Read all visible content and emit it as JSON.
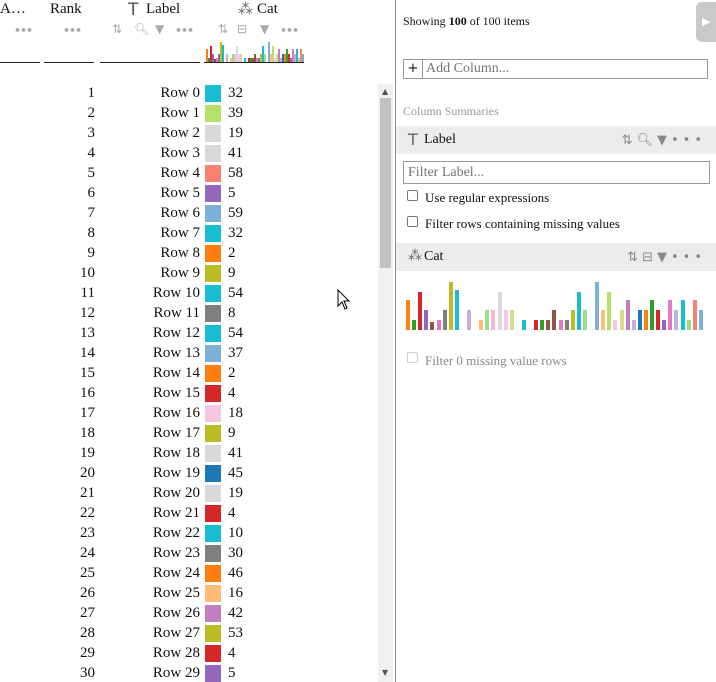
{
  "header": {
    "col_a": "A…",
    "rank": "Rank",
    "label": "Label",
    "cat": "Cat",
    "more_dots": "•••"
  },
  "rows": [
    {
      "rank": "1",
      "label": "Row 0",
      "cat": "32",
      "color": "#17becf"
    },
    {
      "rank": "2",
      "label": "Row 1",
      "cat": "39",
      "color": "#b5e06a"
    },
    {
      "rank": "3",
      "label": "Row 2",
      "cat": "19",
      "color": "#d9d9d9"
    },
    {
      "rank": "4",
      "label": "Row 3",
      "cat": "41",
      "color": "#d9d9d9"
    },
    {
      "rank": "5",
      "label": "Row 4",
      "cat": "58",
      "color": "#fa8072"
    },
    {
      "rank": "6",
      "label": "Row 5",
      "cat": "5",
      "color": "#9467bd"
    },
    {
      "rank": "7",
      "label": "Row 6",
      "cat": "59",
      "color": "#7fb1d6"
    },
    {
      "rank": "8",
      "label": "Row 7",
      "cat": "32",
      "color": "#17becf"
    },
    {
      "rank": "9",
      "label": "Row 8",
      "cat": "2",
      "color": "#ff7f0e"
    },
    {
      "rank": "10",
      "label": "Row 9",
      "cat": "9",
      "color": "#bcbd22"
    },
    {
      "rank": "11",
      "label": "Row 10",
      "cat": "54",
      "color": "#17becf"
    },
    {
      "rank": "12",
      "label": "Row 11",
      "cat": "8",
      "color": "#7f7f7f"
    },
    {
      "rank": "13",
      "label": "Row 12",
      "cat": "54",
      "color": "#17becf"
    },
    {
      "rank": "14",
      "label": "Row 13",
      "cat": "37",
      "color": "#7fb1d6"
    },
    {
      "rank": "15",
      "label": "Row 14",
      "cat": "2",
      "color": "#ff7f0e"
    },
    {
      "rank": "16",
      "label": "Row 15",
      "cat": "4",
      "color": "#d62728"
    },
    {
      "rank": "17",
      "label": "Row 16",
      "cat": "18",
      "color": "#f7c6e3"
    },
    {
      "rank": "18",
      "label": "Row 17",
      "cat": "9",
      "color": "#bcbd22"
    },
    {
      "rank": "19",
      "label": "Row 18",
      "cat": "41",
      "color": "#d9d9d9"
    },
    {
      "rank": "20",
      "label": "Row 19",
      "cat": "45",
      "color": "#1f77b4"
    },
    {
      "rank": "21",
      "label": "Row 20",
      "cat": "19",
      "color": "#d9d9d9"
    },
    {
      "rank": "22",
      "label": "Row 21",
      "cat": "4",
      "color": "#d62728"
    },
    {
      "rank": "23",
      "label": "Row 22",
      "cat": "10",
      "color": "#17becf"
    },
    {
      "rank": "24",
      "label": "Row 23",
      "cat": "30",
      "color": "#7f7f7f"
    },
    {
      "rank": "25",
      "label": "Row 24",
      "cat": "46",
      "color": "#ff7f0e"
    },
    {
      "rank": "26",
      "label": "Row 25",
      "cat": "16",
      "color": "#ffbb78"
    },
    {
      "rank": "27",
      "label": "Row 26",
      "cat": "42",
      "color": "#c07fc0"
    },
    {
      "rank": "28",
      "label": "Row 27",
      "cat": "53",
      "color": "#bcbd22"
    },
    {
      "rank": "29",
      "label": "Row 28",
      "cat": "4",
      "color": "#d62728"
    },
    {
      "rank": "30",
      "label": "Row 29",
      "cat": "5",
      "color": "#9467bd"
    }
  ],
  "side": {
    "showing_prefix": "Showing ",
    "showing_count": "100",
    "showing_suffix": " of 100 items",
    "add_column_placeholder": "Add Column...",
    "add_column_plus": "+",
    "summaries_title": "Column Summaries",
    "label_section": {
      "name": "Label",
      "filter_placeholder": "Filter Label...",
      "regex_label": "Use regular expressions",
      "missing_label": "Filter rows containing missing values"
    },
    "cat_section": {
      "name": "Cat",
      "missing_label": "Filter 0 missing value rows"
    }
  },
  "cat_histogram": [
    {
      "h": 30,
      "c": "#ff7f0e"
    },
    {
      "h": 10,
      "c": "#2ca02c"
    },
    {
      "h": 38,
      "c": "#d62728"
    },
    {
      "h": 20,
      "c": "#9467bd"
    },
    {
      "h": 8,
      "c": "#8c564b"
    },
    {
      "h": 10,
      "c": "#e377c2"
    },
    {
      "h": 20,
      "c": "#7f7f7f"
    },
    {
      "h": 48,
      "c": "#bcbd22"
    },
    {
      "h": 40,
      "c": "#17becf"
    },
    {
      "h": 0,
      "c": "#ffffff"
    },
    {
      "h": 20,
      "c": "#c5b0d5"
    },
    {
      "h": 0,
      "c": "#ffffff"
    },
    {
      "h": 10,
      "c": "#ffbb78"
    },
    {
      "h": 20,
      "c": "#98df8a"
    },
    {
      "h": 20,
      "c": "#f7b6d2"
    },
    {
      "h": 38,
      "c": "#d9d9d9"
    },
    {
      "h": 20,
      "c": "#f7c6e3"
    },
    {
      "h": 20,
      "c": "#dbdb8d"
    },
    {
      "h": 0,
      "c": "#ffffff"
    },
    {
      "h": 10,
      "c": "#17becf"
    },
    {
      "h": 0,
      "c": "#ffffff"
    },
    {
      "h": 10,
      "c": "#d62728"
    },
    {
      "h": 10,
      "c": "#2ca02c"
    },
    {
      "h": 10,
      "c": "#8c564b"
    },
    {
      "h": 20,
      "c": "#8c564b"
    },
    {
      "h": 10,
      "c": "#e377c2"
    },
    {
      "h": 10,
      "c": "#7f7f7f"
    },
    {
      "h": 20,
      "c": "#bcbd22"
    },
    {
      "h": 38,
      "c": "#17becf"
    },
    {
      "h": 20,
      "c": "#98df8a"
    },
    {
      "h": 0,
      "c": "#ffffff"
    },
    {
      "h": 48,
      "c": "#7fb1d6"
    },
    {
      "h": 20,
      "c": "#ffbb78"
    },
    {
      "h": 38,
      "c": "#b5e06a"
    },
    {
      "h": 10,
      "c": "#f7c6e3"
    },
    {
      "h": 20,
      "c": "#dbdb8d"
    },
    {
      "h": 30,
      "c": "#c07fc0"
    },
    {
      "h": 10,
      "c": "#c5b0d5"
    },
    {
      "h": 20,
      "c": "#1f77b4"
    },
    {
      "h": 20,
      "c": "#ff7f0e"
    },
    {
      "h": 30,
      "c": "#2ca02c"
    },
    {
      "h": 20,
      "c": "#d62728"
    },
    {
      "h": 10,
      "c": "#9467bd"
    },
    {
      "h": 30,
      "c": "#e377c2"
    },
    {
      "h": 20,
      "c": "#c5b0d5"
    },
    {
      "h": 30,
      "c": "#17becf"
    },
    {
      "h": 10,
      "c": "#98df8a"
    },
    {
      "h": 30,
      "c": "#fa8072"
    },
    {
      "h": 20,
      "c": "#7fb1d6"
    }
  ]
}
